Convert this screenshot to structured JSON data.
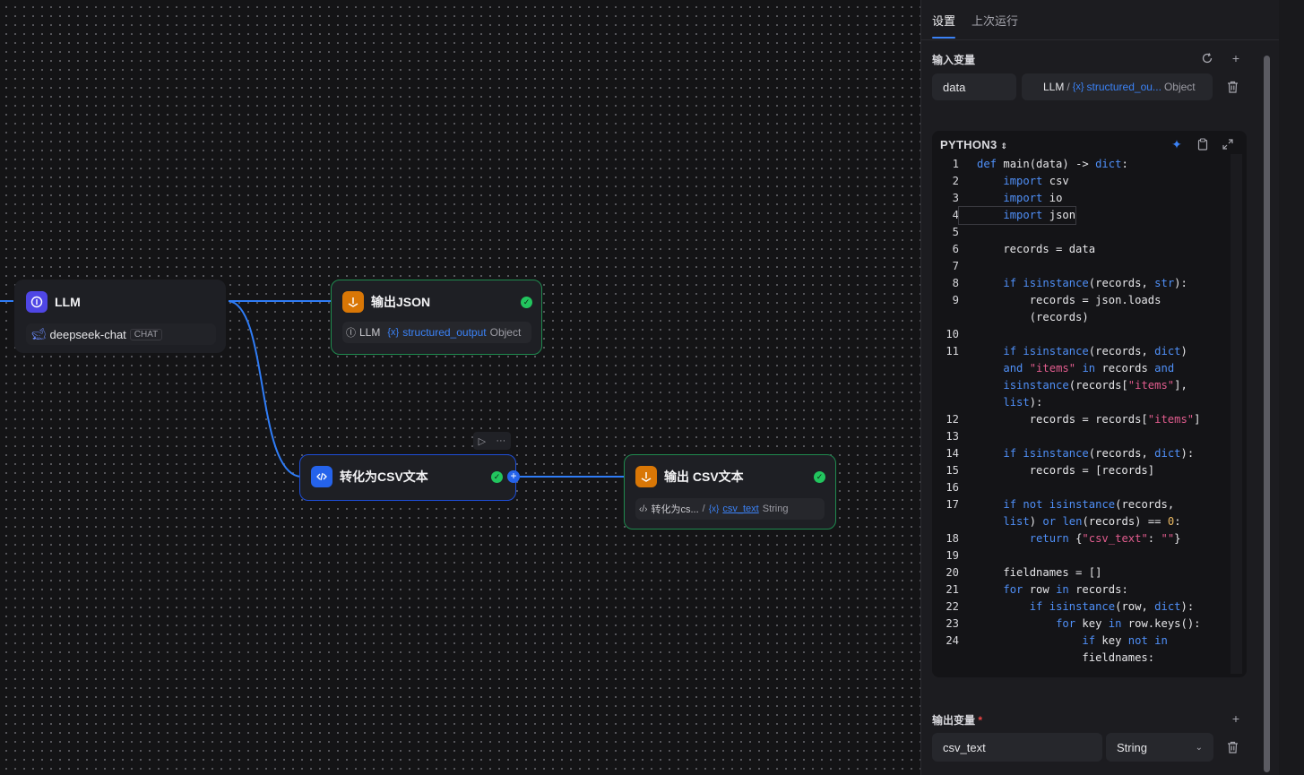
{
  "canvas": {
    "llm_node": {
      "title": "LLM",
      "model": "deepseek-chat",
      "model_tag": "CHAT"
    },
    "json_node": {
      "title": "输出JSON",
      "ref_node": "LLM",
      "var_prefix": "{x}",
      "var_name": "structured_output",
      "var_type": "Object"
    },
    "csv_node": {
      "title": "转化为CSV文本",
      "toolbar_run": "▷",
      "toolbar_more": "···"
    },
    "csv_out_node": {
      "title": "输出 CSV文本",
      "ref_node": "转化为cs...",
      "var_prefix": "{x}",
      "var_name": "csv_text",
      "var_type": "String"
    }
  },
  "panel": {
    "tabs": [
      "设置",
      "上次运行"
    ],
    "input_vars": {
      "title": "输入变量",
      "name": "data",
      "ref_node": "LLM",
      "ref_sep": "/",
      "ref_prefix": "{x}",
      "ref_var": "structured_ou...",
      "ref_type": "Object"
    },
    "code": {
      "language": "PYTHON3",
      "lines": [
        {
          "n": "1",
          "t": "def main(data) -> dict:"
        },
        {
          "n": "2",
          "t": "    import csv"
        },
        {
          "n": "3",
          "t": "    import io"
        },
        {
          "n": "4",
          "t": "    import json"
        },
        {
          "n": "5",
          "t": ""
        },
        {
          "n": "6",
          "t": "    records = data"
        },
        {
          "n": "7",
          "t": ""
        },
        {
          "n": "8",
          "t": "    if isinstance(records, str):"
        },
        {
          "n": "9",
          "t": "        records = json.loads"
        },
        {
          "n": "",
          "t": "        (records)"
        },
        {
          "n": "10",
          "t": ""
        },
        {
          "n": "11",
          "t": "    if isinstance(records, dict)"
        },
        {
          "n": "",
          "t": "    and \"items\" in records and"
        },
        {
          "n": "",
          "t": "    isinstance(records[\"items\"],"
        },
        {
          "n": "",
          "t": "    list):"
        },
        {
          "n": "12",
          "t": "        records = records[\"items\"]"
        },
        {
          "n": "13",
          "t": ""
        },
        {
          "n": "14",
          "t": "    if isinstance(records, dict):"
        },
        {
          "n": "15",
          "t": "        records = [records]"
        },
        {
          "n": "16",
          "t": ""
        },
        {
          "n": "17",
          "t": "    if not isinstance(records,"
        },
        {
          "n": "",
          "t": "    list) or len(records) == 0:"
        },
        {
          "n": "18",
          "t": "        return {\"csv_text\": \"\"}"
        },
        {
          "n": "19",
          "t": ""
        },
        {
          "n": "20",
          "t": "    fieldnames = []"
        },
        {
          "n": "21",
          "t": "    for row in records:"
        },
        {
          "n": "22",
          "t": "        if isinstance(row, dict):"
        },
        {
          "n": "23",
          "t": "            for key in row.keys():"
        },
        {
          "n": "24",
          "t": "                if key not in"
        },
        {
          "n": "",
          "t": "                fieldnames:"
        }
      ]
    },
    "output_vars": {
      "title": "输出变量",
      "required_mark": "*",
      "name": "csv_text",
      "type": "String"
    }
  },
  "colors": {
    "accent": "#3b82f6",
    "success": "#22c55e",
    "node_bg": "#1e1f24"
  }
}
